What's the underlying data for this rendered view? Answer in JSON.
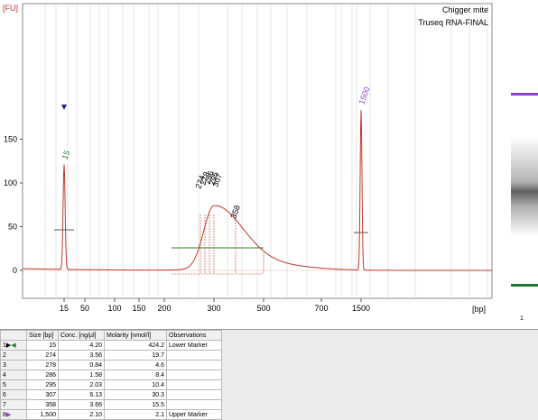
{
  "header": {
    "sample_name": "Chigger mite",
    "run_name": "Truseq RNA-FINAL"
  },
  "chart_data": {
    "type": "line",
    "ylabel": "[FU]",
    "xlabel": "[bp]",
    "y_ticks": [
      0,
      50,
      100,
      150
    ],
    "x_ticks": [
      "15",
      "50",
      "100",
      "150",
      "200",
      "300",
      "500",
      "700",
      "1500"
    ],
    "ylim": [
      -10,
      190
    ],
    "peaks": [
      {
        "label": "15",
        "bp": 15,
        "height": 120,
        "color": "#2e7d32"
      },
      {
        "label": "1500",
        "bp": 1500,
        "height": 183,
        "color": "#8a3fc5"
      }
    ],
    "smear_peak_labels": [
      "274",
      "278",
      "286",
      "295",
      "307",
      "358"
    ],
    "series": [
      {
        "color": "#c0392b"
      }
    ]
  },
  "gel": {
    "lane_label": "1",
    "upper_marker_color": "#8a3fc5",
    "lower_marker_color": "#1b7a2e"
  },
  "table": {
    "columns": [
      "",
      "Size [bp]",
      "Conc. [ng/µl]",
      "Molarity [nmol/l]",
      "Observations"
    ],
    "rows": [
      {
        "id": "1",
        "size": "15",
        "conc": "4.20",
        "molarity": "424.2",
        "obs": "Lower Marker"
      },
      {
        "id": "2",
        "size": "274",
        "conc": "3.56",
        "molarity": "19.7",
        "obs": ""
      },
      {
        "id": "3",
        "size": "278",
        "conc": "0.84",
        "molarity": "4.6",
        "obs": ""
      },
      {
        "id": "4",
        "size": "286",
        "conc": "1.58",
        "molarity": "8.4",
        "obs": ""
      },
      {
        "id": "5",
        "size": "295",
        "conc": "2.03",
        "molarity": "10.4",
        "obs": ""
      },
      {
        "id": "6",
        "size": "307",
        "conc": "6.13",
        "molarity": "30.3",
        "obs": ""
      },
      {
        "id": "7",
        "size": "358",
        "conc": "3.66",
        "molarity": "15.5",
        "obs": ""
      },
      {
        "id": "8",
        "size": "1,500",
        "conc": "2.10",
        "molarity": "2.1",
        "obs": "Upper Marker"
      }
    ]
  }
}
